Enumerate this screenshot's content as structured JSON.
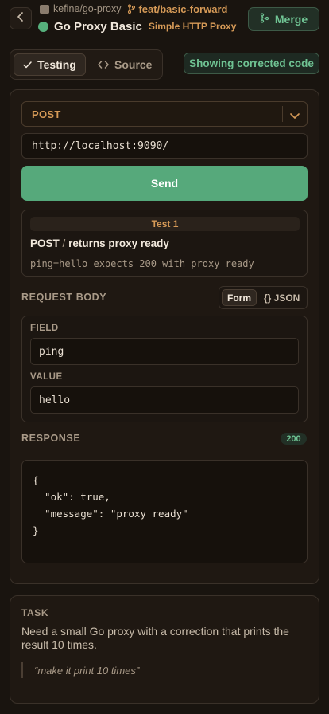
{
  "header": {
    "repo": "kefine/go-proxy",
    "branch": "feat/basic-forward",
    "title": "Go Proxy Basic",
    "subtitle": "Simple HTTP Proxy",
    "merge_label": "Merge"
  },
  "tabs": [
    {
      "label": "Testing",
      "icon": "check-icon",
      "active": true
    },
    {
      "label": "Source",
      "icon": "code-icon",
      "active": false
    }
  ],
  "corrected_badge": "Showing corrected code",
  "request": {
    "method": "POST",
    "url": "http://localhost:9090/",
    "send_label": "Send"
  },
  "test": {
    "tab_label": "Test 1",
    "method": "POST",
    "separator": "/",
    "name": "returns proxy ready",
    "description": "ping=hello expects 200 with proxy ready"
  },
  "request_body": {
    "label": "REQUEST BODY",
    "toggle": {
      "form": "Form",
      "json": "{} JSON",
      "selected": "Form"
    },
    "field_label": "FIELD",
    "field_value": "ping",
    "value_label": "VALUE",
    "value_value": "hello"
  },
  "response": {
    "label": "RESPONSE",
    "status": "200",
    "lines": [
      "{",
      "  \"ok\": true,",
      "  \"message\": \"proxy ready\"",
      "}"
    ]
  },
  "task": {
    "label": "TASK",
    "description": "Need a small Go proxy with a correction that prints the result 10 times.",
    "quote": "“make it print 10 times”"
  },
  "colors": {
    "background": "#19140f",
    "accent_orange": "#d69a57",
    "accent_green": "#56a97b",
    "success_text": "#6fc393"
  }
}
